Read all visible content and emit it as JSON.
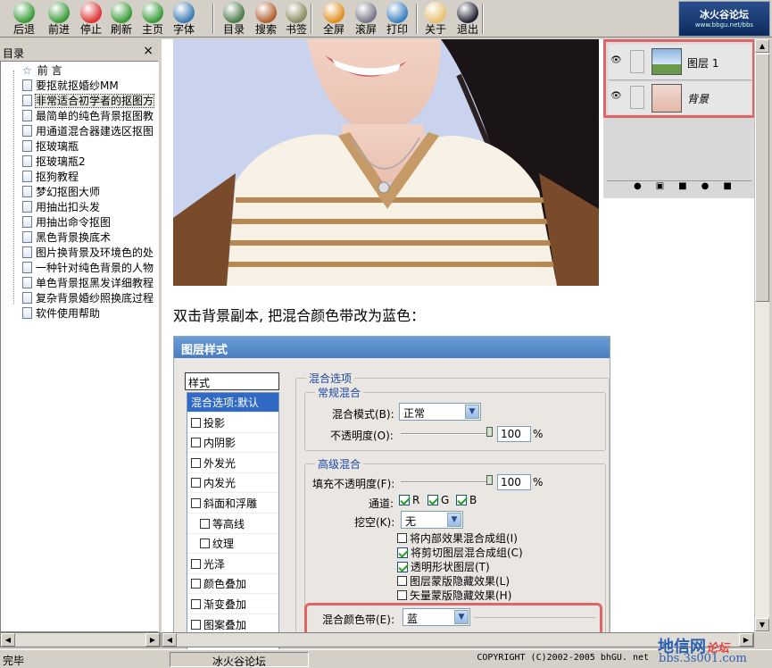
{
  "toolbar": {
    "buttons": [
      {
        "label": "后退",
        "icon": "back-icon"
      },
      {
        "label": "前进",
        "icon": "forward-icon"
      },
      {
        "label": "停止",
        "icon": "stop-icon"
      },
      {
        "label": "刷新",
        "icon": "refresh-icon"
      },
      {
        "label": "主页",
        "icon": "home-icon"
      },
      {
        "label": "字体",
        "icon": "font-icon"
      },
      {
        "label": "目录",
        "icon": "toc-icon"
      },
      {
        "label": "搜索",
        "icon": "search-icon"
      },
      {
        "label": "书签",
        "icon": "bookmark-icon"
      },
      {
        "label": "全屏",
        "icon": "fullscreen-icon"
      },
      {
        "label": "滚屏",
        "icon": "scroll-icon"
      },
      {
        "label": "打印",
        "icon": "print-icon"
      },
      {
        "label": "关于",
        "icon": "about-icon"
      },
      {
        "label": "退出",
        "icon": "exit-icon"
      }
    ],
    "brand": "冰火谷论坛",
    "brand_url": "www.bbgu.net/bbs"
  },
  "sidebar": {
    "title": "目录",
    "close": "×",
    "items": [
      {
        "label": "前 言",
        "root": true
      },
      {
        "label": "要抠就抠婚纱MM"
      },
      {
        "label": "非常适合初学者的抠图方"
      },
      {
        "label": "最简单的纯色背景抠图教"
      },
      {
        "label": "用通道混合器建选区抠图"
      },
      {
        "label": "抠玻璃瓶"
      },
      {
        "label": "抠玻璃瓶2"
      },
      {
        "label": "抠狗教程"
      },
      {
        "label": "梦幻抠图大师"
      },
      {
        "label": "用抽出扣头发"
      },
      {
        "label": "用抽出命令抠图"
      },
      {
        "label": "黑色背景换底术"
      },
      {
        "label": "图片换背景及环境色的处"
      },
      {
        "label": "一种针对纯色背景的人物"
      },
      {
        "label": "单色背景抠黑发详细教程"
      },
      {
        "label": "复杂背景婚纱照换底过程"
      },
      {
        "label": "软件使用帮助"
      }
    ]
  },
  "layers": {
    "layer1": "图层 1",
    "background": "背景"
  },
  "caption": "双击背景副本, 把混合颜色带改为蓝色：",
  "dialog": {
    "title": "图层样式",
    "styles_header": "样式",
    "styles": [
      {
        "label": "混合选项:默认",
        "selected": true
      },
      {
        "label": "投影"
      },
      {
        "label": "内阴影"
      },
      {
        "label": "外发光"
      },
      {
        "label": "内发光"
      },
      {
        "label": "斜面和浮雕"
      },
      {
        "label": "等高线",
        "indent": true
      },
      {
        "label": "纹理",
        "indent": true
      },
      {
        "label": "光泽"
      },
      {
        "label": "颜色叠加"
      },
      {
        "label": "渐变叠加"
      },
      {
        "label": "图案叠加"
      }
    ],
    "blend_options": "混合选项",
    "general": "常规混合",
    "blend_mode_label": "混合模式(B):",
    "blend_mode_value": "正常",
    "opacity_label": "不透明度(O):",
    "opacity_value": "100",
    "percent": "%",
    "advanced": "高级混合",
    "fill_label": "填充不透明度(F):",
    "fill_value": "100",
    "channels_label": "通道:",
    "ch_r": "R",
    "ch_g": "G",
    "ch_b": "B",
    "knockout_label": "挖空(K):",
    "knockout_value": "无",
    "options": [
      {
        "label": "将内部效果混合成组(I)",
        "checked": false
      },
      {
        "label": "将剪切图层混合成组(C)",
        "checked": true
      },
      {
        "label": "透明形状图层(T)",
        "checked": true
      },
      {
        "label": "图层蒙版隐藏效果(L)",
        "checked": false
      },
      {
        "label": "矢量蒙版隐藏效果(H)",
        "checked": false
      }
    ],
    "blend_if_label": "混合颜色带(E):",
    "blend_if_value": "蓝"
  },
  "status": {
    "left": "完毕",
    "middle": "冰火谷论坛",
    "copyright": "COPYRIGHT (C)2002-2005  bhGU. net",
    "watermark_site": "地信网",
    "watermark_sub": "论坛",
    "watermark_url": "bbs.3s001.com"
  }
}
